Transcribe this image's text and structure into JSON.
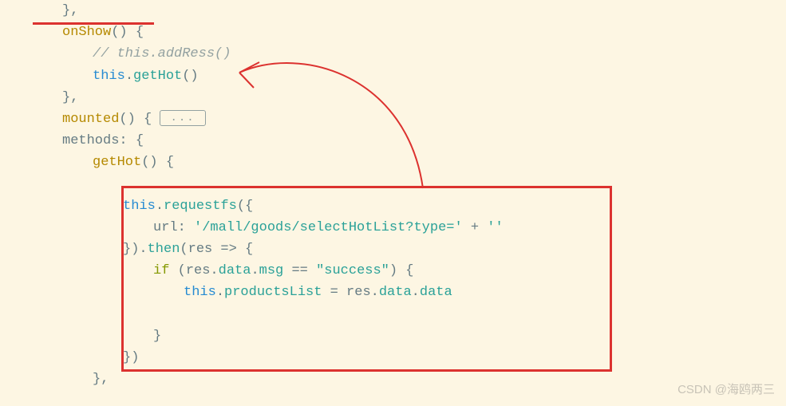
{
  "code": {
    "line1": "},",
    "onShow": "onShow",
    "comment_addRess": "// this.addRess()",
    "this_kw": "this",
    "getHot_call": "getHot",
    "mounted": "mounted",
    "fold_label": "...",
    "methods": "methods",
    "getHot_def": "getHot",
    "requestfs": "requestfs",
    "url_key": "url",
    "url_value": "'/mall/goods/selectHotList?type='",
    "plus": " + ",
    "empty_str": "''",
    "then": "then",
    "res": "res",
    "arrow": " => ",
    "if_kw": "if",
    "res_data_msg": "res",
    "data_prop": "data",
    "msg_prop": "msg",
    "eq": " == ",
    "success_str": "\"success\"",
    "productsList": "productsList",
    "assign": " = ",
    "data_prop2": "data"
  },
  "watermark": "CSDN @海鸥两三"
}
